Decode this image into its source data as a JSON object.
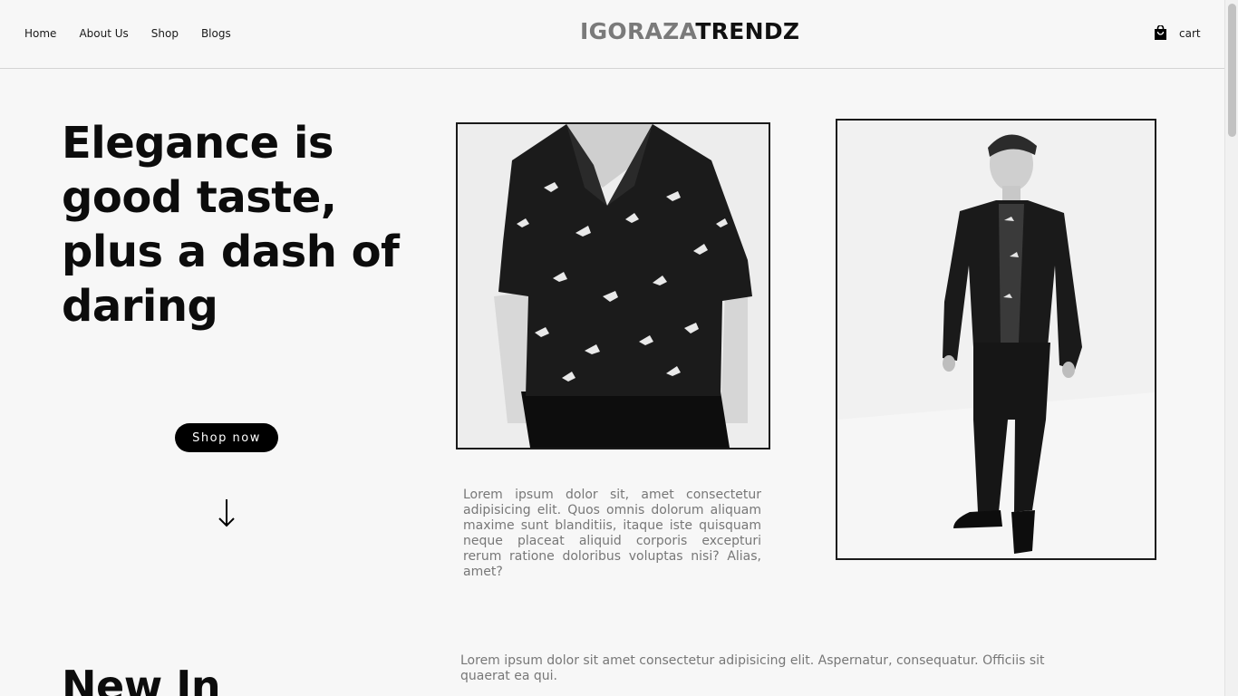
{
  "nav": {
    "items": [
      {
        "label": "Home"
      },
      {
        "label": "About Us"
      },
      {
        "label": "Shop"
      },
      {
        "label": "Blogs"
      }
    ]
  },
  "logo": {
    "part1": "IGORAZA",
    "part2": "TRENDZ"
  },
  "cart": {
    "label": "cart",
    "icon": "shopping-bag-icon"
  },
  "hero": {
    "headline": "Elegance is good taste, plus a dash of daring",
    "cta_label": "Shop now",
    "arrow_icon": "arrow-down-icon",
    "description": "Lorem ipsum dolor sit, amet consectetur adipisicing elit. Quos omnis dolorum aliquam maxime sunt blanditiis, itaque iste quisquam neque placeat aliquid corporis excepturi rerum ratione doloribus voluptas nisi? Alias, amet?"
  },
  "new_in": {
    "title": "New In",
    "description": "Lorem ipsum dolor sit amet consectetur adipisicing elit. Aspernatur, consequatur. Officiis sit quaerat ea qui."
  },
  "colors": {
    "background": "#f7f7f7",
    "accent": "#000000",
    "muted_text": "#777777",
    "logo_gray": "#7a7a7a"
  }
}
